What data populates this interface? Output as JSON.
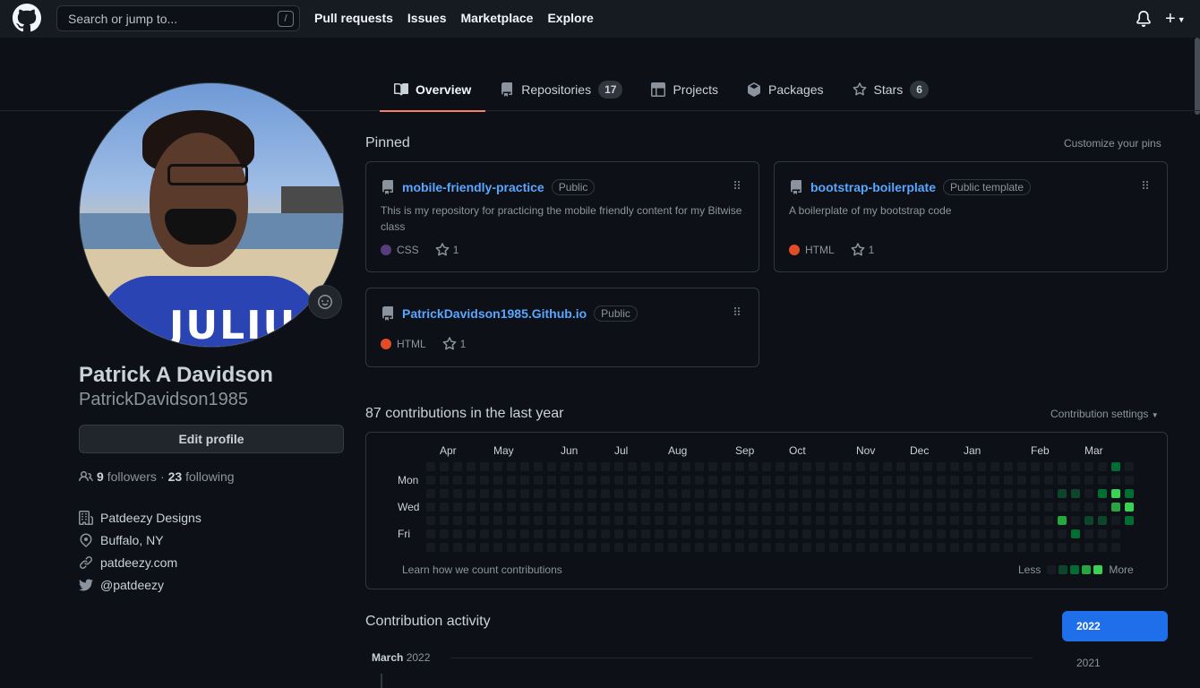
{
  "header": {
    "search_placeholder": "Search or jump to...",
    "search_shortcut": "/",
    "nav": [
      "Pull requests",
      "Issues",
      "Marketplace",
      "Explore"
    ],
    "plus_icon": "+"
  },
  "tabs": [
    {
      "label": "Overview",
      "icon": "book-icon",
      "count": null,
      "active": true
    },
    {
      "label": "Repositories",
      "icon": "repo-icon",
      "count": "17",
      "active": false
    },
    {
      "label": "Projects",
      "icon": "table-icon",
      "count": null,
      "active": false
    },
    {
      "label": "Packages",
      "icon": "package-icon",
      "count": null,
      "active": false
    },
    {
      "label": "Stars",
      "icon": "star-icon",
      "count": "6",
      "active": false
    }
  ],
  "profile": {
    "fullname": "Patrick A Davidson",
    "username": "PatrickDavidson1985",
    "edit_label": "Edit profile",
    "followers_count": "9",
    "followers_label": "followers",
    "following_count": "23",
    "following_label": "following",
    "separator": "·",
    "company": "Patdeezy Designs",
    "location": "Buffalo, NY",
    "website": "patdeezy.com",
    "twitter": "@patdeezy",
    "avatar_text": "JULIUS"
  },
  "pinned": {
    "title": "Pinned",
    "customize": "Customize your pins",
    "items": [
      {
        "name": "mobile-friendly-practice",
        "visibility": "Public",
        "description": "This is my repository for practicing the mobile friendly content for my Bitwise class",
        "language": "CSS",
        "lang_color": "#563d7c",
        "stars": "1"
      },
      {
        "name": "bootstrap-boilerplate",
        "visibility": "Public template",
        "description": "A boilerplate of my bootstrap code",
        "language": "HTML",
        "lang_color": "#e34c26",
        "stars": "1"
      },
      {
        "name": "PatrickDavidson1985.Github.io",
        "visibility": "Public",
        "description": "",
        "language": "HTML",
        "lang_color": "#e34c26",
        "stars": "1"
      }
    ]
  },
  "contributions": {
    "title": "87 contributions in the last year",
    "settings": "Contribution settings",
    "months": [
      "Apr",
      "May",
      "Jun",
      "Jul",
      "Aug",
      "Sep",
      "Oct",
      "Nov",
      "Dec",
      "Jan",
      "Feb",
      "Mar"
    ],
    "days": [
      "Mon",
      "Wed",
      "Fri"
    ],
    "learn": "Learn how we count contributions",
    "less": "Less",
    "more": "More",
    "colors": [
      "#161b22",
      "#0e4429",
      "#006d32",
      "#26a641",
      "#39d353"
    ],
    "active_cells": [
      {
        "week": 51,
        "day": 0,
        "level": 2
      },
      {
        "week": 47,
        "day": 2,
        "level": 1
      },
      {
        "week": 48,
        "day": 2,
        "level": 1
      },
      {
        "week": 50,
        "day": 2,
        "level": 2
      },
      {
        "week": 51,
        "day": 2,
        "level": 4
      },
      {
        "week": 52,
        "day": 2,
        "level": 2
      },
      {
        "week": 51,
        "day": 3,
        "level": 3
      },
      {
        "week": 52,
        "day": 3,
        "level": 4
      },
      {
        "week": 47,
        "day": 4,
        "level": 3
      },
      {
        "week": 49,
        "day": 4,
        "level": 1
      },
      {
        "week": 50,
        "day": 4,
        "level": 1
      },
      {
        "week": 52,
        "day": 4,
        "level": 2
      },
      {
        "week": 48,
        "day": 5,
        "level": 2
      }
    ]
  },
  "activity": {
    "title": "Contribution activity",
    "month": "March",
    "year": "2022",
    "years": [
      "2022",
      "2021"
    ]
  }
}
